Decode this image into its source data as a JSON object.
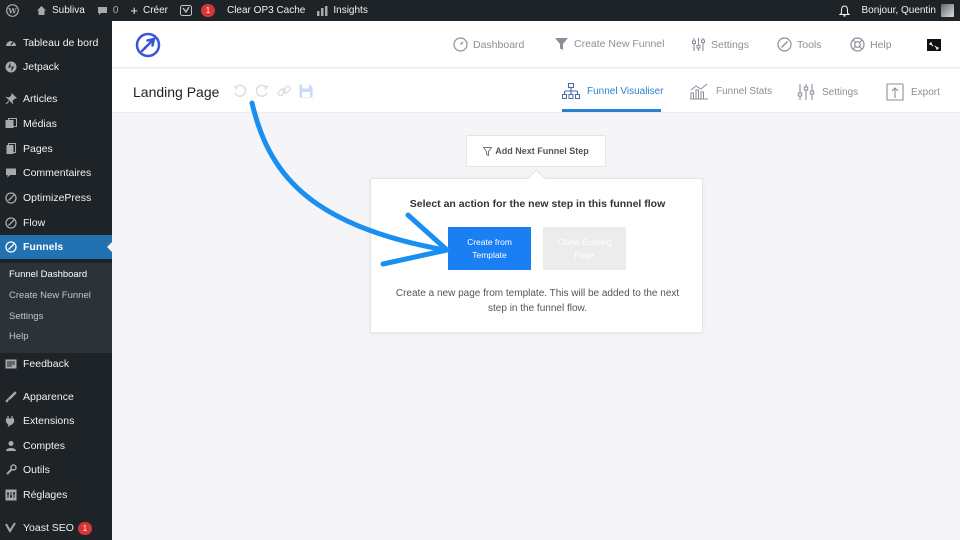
{
  "admin_bar": {
    "site_name": "Subliva",
    "comments_count": "0",
    "new_label": "Créer",
    "yoast_badge": "1",
    "clear_cache": "Clear OP3 Cache",
    "insights": "Insights",
    "greeting": "Bonjour, Quentin"
  },
  "sidebar": {
    "items": [
      {
        "label": "Tableau de bord",
        "icon": "dashboard-icon"
      },
      {
        "label": "Jetpack",
        "icon": "jetpack-icon"
      },
      {
        "label": "Articles",
        "icon": "pin-icon"
      },
      {
        "label": "Médias",
        "icon": "media-icon"
      },
      {
        "label": "Pages",
        "icon": "pages-icon"
      },
      {
        "label": "Commentaires",
        "icon": "comments-icon"
      },
      {
        "label": "OptimizePress",
        "icon": "optimizepress-icon"
      },
      {
        "label": "Flow",
        "icon": "flow-icon"
      },
      {
        "label": "Funnels",
        "icon": "funnels-icon"
      },
      {
        "label": "Feedback",
        "icon": "feedback-icon"
      },
      {
        "label": "Apparence",
        "icon": "appearance-icon"
      },
      {
        "label": "Extensions",
        "icon": "plugins-icon"
      },
      {
        "label": "Comptes",
        "icon": "users-icon"
      },
      {
        "label": "Outils",
        "icon": "tools-icon"
      },
      {
        "label": "Réglages",
        "icon": "settings-icon"
      },
      {
        "label": "Yoast SEO",
        "icon": "yoast-icon",
        "badge": "1"
      }
    ],
    "submenu": [
      "Funnel Dashboard",
      "Create New Funnel",
      "Settings",
      "Help"
    ]
  },
  "header_nav": {
    "dashboard": "Dashboard",
    "create_funnel": "Create New Funnel",
    "settings": "Settings",
    "tools": "Tools",
    "help": "Help"
  },
  "subheader": {
    "title": "Landing Page",
    "tabs": {
      "visualiser": "Funnel Visualiser",
      "stats": "Funnel Stats",
      "settings": "Settings",
      "export": "Export"
    }
  },
  "canvas": {
    "add_step": "Add Next Funnel Step",
    "popup": {
      "title": "Select an action for the new step in this funnel flow",
      "primary_button": "Create from Template",
      "secondary_button": "Clone Existing Page",
      "description": "Create a new page from template. This will be added to the next step in the funnel flow."
    }
  },
  "colors": {
    "accent": "#2d7fd3",
    "primary_button": "#1a7ff3",
    "admin_dark": "#1d2327",
    "wp_active": "#2271b1",
    "arrow": "#1a8ff2"
  }
}
